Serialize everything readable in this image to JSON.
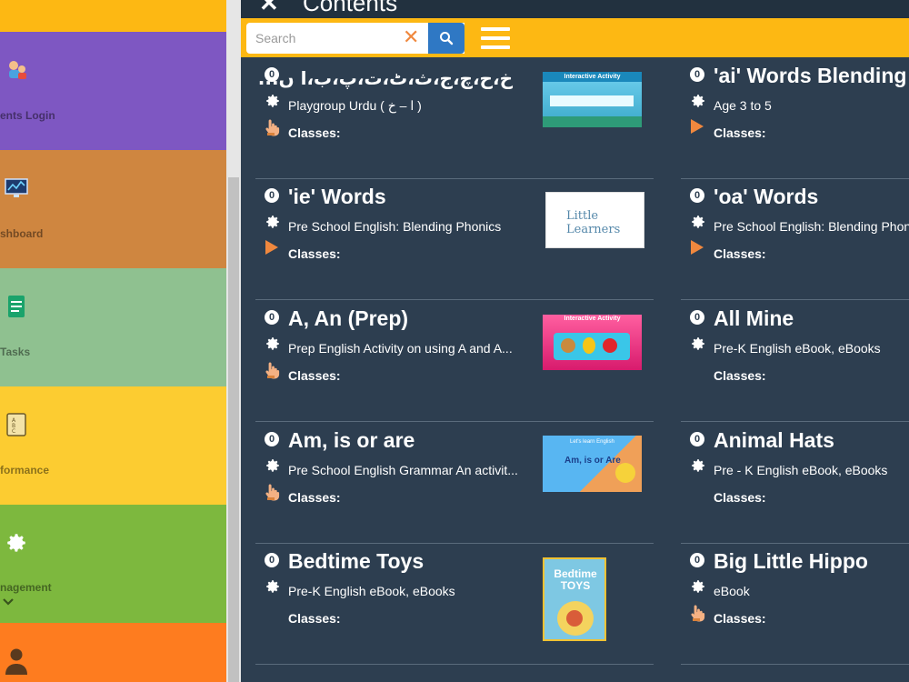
{
  "sidebar": {
    "tiles": [
      {
        "label": "ents Login",
        "icon": "parents-icon"
      },
      {
        "label": "shboard",
        "icon": "dashboard-icon"
      },
      {
        "label": "Tasks",
        "icon": "tasks-icon"
      },
      {
        "label": "formance",
        "icon": "performance-icon"
      },
      {
        "label": "nagement",
        "icon": "gear-icon"
      },
      {
        "label": "",
        "icon": "user-icon"
      }
    ]
  },
  "header": {
    "title": "Contents",
    "search_placeholder": "Search"
  },
  "cards": [
    {
      "title": "خ،ح،چ،ج،ث،ٹ،ت،پ،ب،ا ں...",
      "subtitle": "Playgroup Urdu ( ا – خ )",
      "classes": "Classes:",
      "action": "hand"
    },
    {
      "title": "'ai' Words Blending P",
      "subtitle": "Age 3 to 5",
      "classes": "Classes:",
      "action": "play"
    },
    {
      "title": "'ie' Words",
      "subtitle": "Pre School English: Blending Phonics",
      "classes": "Classes:",
      "action": "play"
    },
    {
      "title": "'oa' Words",
      "subtitle": "Pre School English: Blending Phon",
      "classes": "Classes:",
      "action": "play"
    },
    {
      "title": "A, An (Prep)",
      "subtitle": "Prep English Activity on using A and A...",
      "classes": "Classes:",
      "action": "hand"
    },
    {
      "title": "All Mine",
      "subtitle": "Pre-K English eBook, eBooks",
      "classes": "Classes:",
      "action": ""
    },
    {
      "title": "Am, is or are",
      "subtitle": "Pre School English Grammar An activit...",
      "classes": "Classes:",
      "action": "hand"
    },
    {
      "title": "Animal Hats",
      "subtitle": "Pre - K English eBook, eBooks",
      "classes": "Classes:",
      "action": ""
    },
    {
      "title": "Bedtime Toys",
      "subtitle": "Pre-K English eBook, eBooks",
      "classes": "Classes:",
      "action": ""
    },
    {
      "title": "Big Little Hippo",
      "subtitle": "eBook",
      "classes": "Classes:",
      "action": "hand"
    }
  ],
  "thumbs": {
    "interactive_activity": "Interactive Activity",
    "little_learners": "Little Learners",
    "lets_learn_english": "Let's learn English",
    "am_is_are": "Am, is or Are",
    "bedtime_toys": "Bedtime TOYS"
  },
  "zero_badge": "0",
  "colors": {
    "main_bg": "#2d3e50",
    "search_bar": "#fdb813",
    "search_button": "#2f78c4",
    "accent_orange": "#f0883e"
  }
}
